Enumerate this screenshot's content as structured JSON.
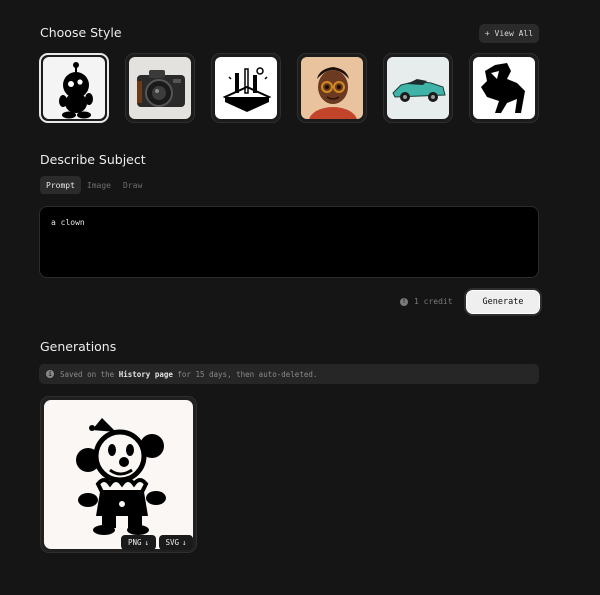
{
  "choose_style": {
    "title": "Choose Style",
    "view_all_label": "+ View All",
    "styles": [
      {
        "icon": "robot-mascot-icon",
        "selected": true
      },
      {
        "icon": "camera-photo-icon",
        "selected": false
      },
      {
        "icon": "isometric-lineart-icon",
        "selected": false
      },
      {
        "icon": "3d-character-icon",
        "selected": false
      },
      {
        "icon": "sports-car-icon",
        "selected": false
      },
      {
        "icon": "lion-silhouette-icon",
        "selected": false
      }
    ]
  },
  "describe": {
    "title": "Describe Subject",
    "tabs": [
      {
        "label": "Prompt",
        "active": true
      },
      {
        "label": "Image",
        "active": false
      },
      {
        "label": "Draw",
        "active": false
      }
    ],
    "prompt_value": "a clown",
    "credit_label": "1 credit",
    "generate_label": "Generate"
  },
  "generations": {
    "title": "Generations",
    "notice_prefix": "Saved on the",
    "notice_link": "History page",
    "notice_suffix": "for 15 days, then auto-deleted.",
    "items": [
      {
        "icon": "clown-illustration-icon",
        "png_label": "PNG",
        "svg_label": "SVG"
      }
    ]
  },
  "colors": {
    "background": "#151515",
    "generate_button": "#efefef",
    "prompt_box": "#000000"
  }
}
